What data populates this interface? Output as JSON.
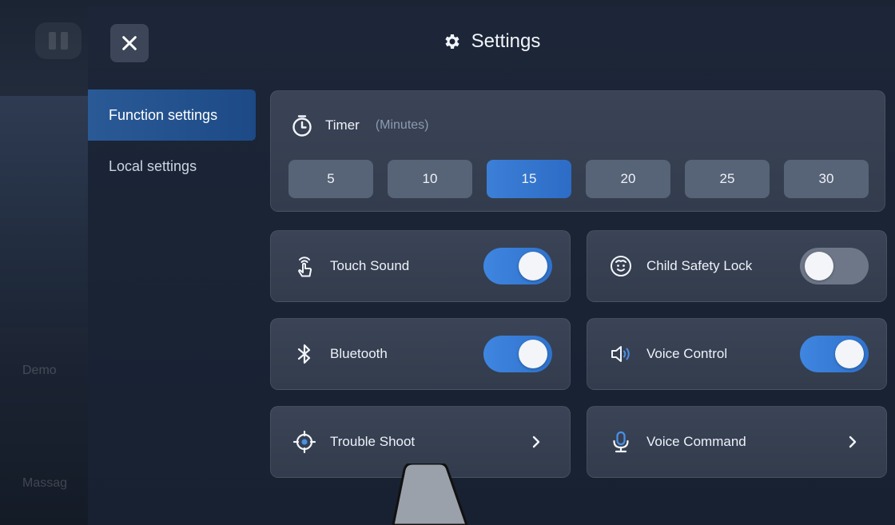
{
  "background": {
    "label_demo": "Demo",
    "label_massage": "Massag"
  },
  "header": {
    "title": "Settings",
    "close_icon": "close-icon",
    "title_icon": "gear-icon"
  },
  "nav": {
    "items": [
      {
        "label": "Function settings",
        "active": true
      },
      {
        "label": "Local settings",
        "active": false
      }
    ]
  },
  "timer": {
    "title": "Timer",
    "unit": "(Minutes)",
    "icon": "stopwatch-icon",
    "options": [
      "5",
      "10",
      "15",
      "20",
      "25",
      "30"
    ],
    "selected": "15"
  },
  "settings": {
    "touch_sound": {
      "label": "Touch Sound",
      "icon": "touch-icon",
      "on": true
    },
    "child_lock": {
      "label": "Child Safety Lock",
      "icon": "child-face-icon",
      "on": false
    },
    "bluetooth": {
      "label": "Bluetooth",
      "icon": "bluetooth-icon",
      "on": true
    },
    "voice_control": {
      "label": "Voice Control",
      "icon": "speaker-icon",
      "on": true
    },
    "trouble_shoot": {
      "label": "Trouble Shoot",
      "icon": "crosshair-icon"
    },
    "voice_command": {
      "label": "Voice Command",
      "icon": "microphone-icon"
    }
  },
  "colors": {
    "accent": "#3c7fd7",
    "toggle_off": "#6d7788",
    "card": "#353f50"
  }
}
